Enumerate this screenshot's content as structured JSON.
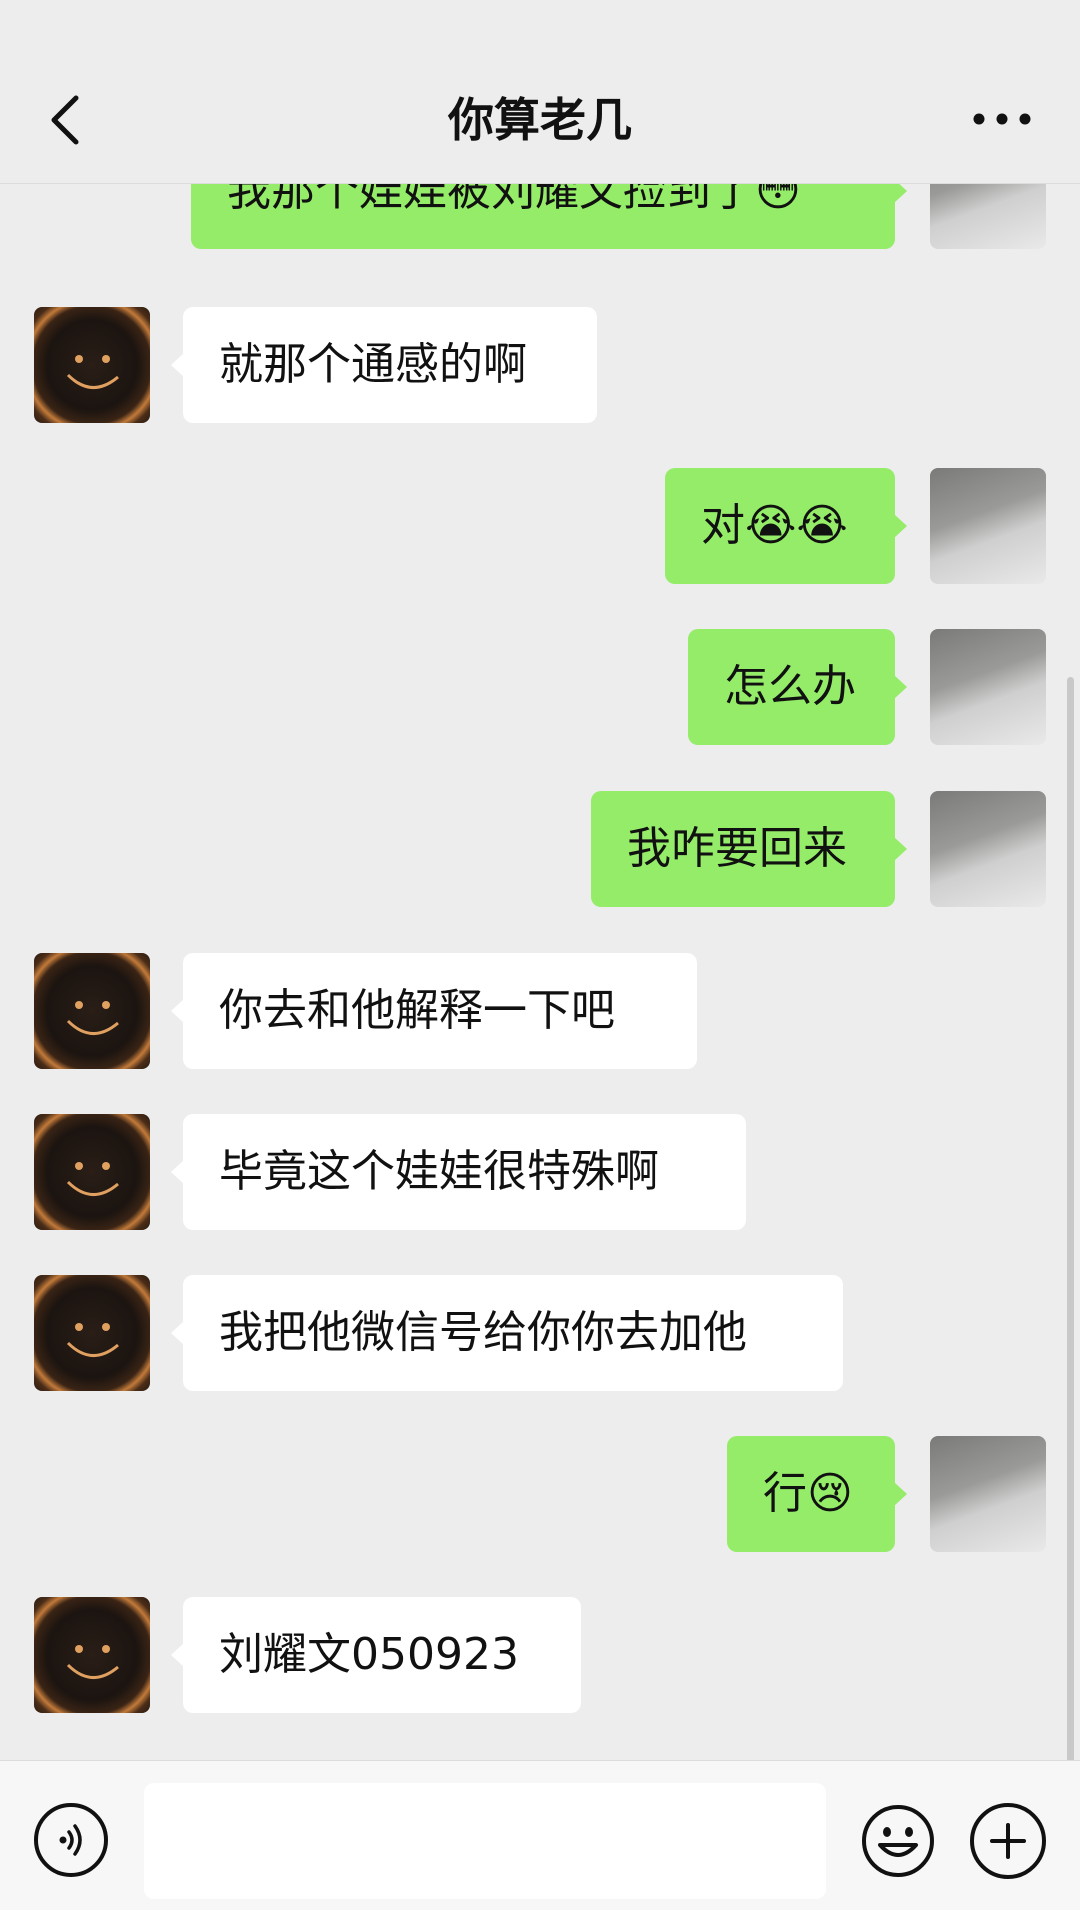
{
  "header": {
    "title": "你算老几",
    "back_icon": "chevron-left-icon",
    "more_icon": "more-dots-icon"
  },
  "messages": [
    {
      "side": "right",
      "text": "我那个娃娃被刘耀文捡到了😳"
    },
    {
      "side": "left",
      "text": "就那个通感的啊"
    },
    {
      "side": "right",
      "text": "对😭😭"
    },
    {
      "side": "right",
      "text": "怎么办"
    },
    {
      "side": "right",
      "text": "我咋要回来"
    },
    {
      "side": "left",
      "text": "你去和他解释一下吧"
    },
    {
      "side": "left",
      "text": "毕竟这个娃娃很特殊啊"
    },
    {
      "side": "left",
      "text": "我把他微信号给你你去加他"
    },
    {
      "side": "right",
      "text": "行😢"
    },
    {
      "side": "left",
      "text": "刘耀文050923"
    }
  ],
  "input": {
    "value": "",
    "placeholder": "",
    "voice_icon": "voice-icon",
    "emoji_icon": "emoji-icon",
    "plus_icon": "plus-icon"
  },
  "colors": {
    "background": "#ededed",
    "outgoing_bubble": "#95ec69",
    "incoming_bubble": "#ffffff"
  }
}
